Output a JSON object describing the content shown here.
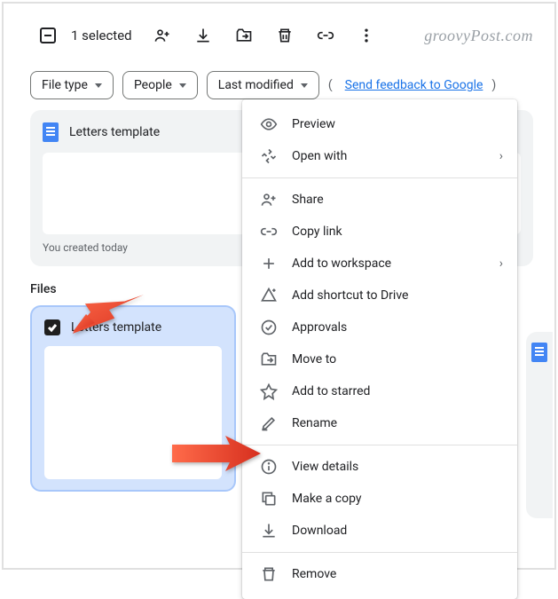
{
  "toolbar": {
    "selection": "1 selected"
  },
  "watermark": "groovyPost.com",
  "filters": {
    "filetype": "File type",
    "people": "People",
    "lastmod": "Last modified"
  },
  "feedback": "Send feedback to Google",
  "suggested_file": {
    "name": "Letters template",
    "meta": "You created today"
  },
  "section": "Files",
  "selected_file": {
    "name": "Letters template"
  },
  "ctx": {
    "preview": "Preview",
    "openwith": "Open with",
    "share": "Share",
    "copylink": "Copy link",
    "addws": "Add to workspace",
    "shortcut": "Add shortcut to Drive",
    "approvals": "Approvals",
    "moveto": "Move to",
    "starred": "Add to starred",
    "rename": "Rename",
    "details": "View details",
    "makecopy": "Make a copy",
    "download": "Download",
    "remove": "Remove"
  }
}
